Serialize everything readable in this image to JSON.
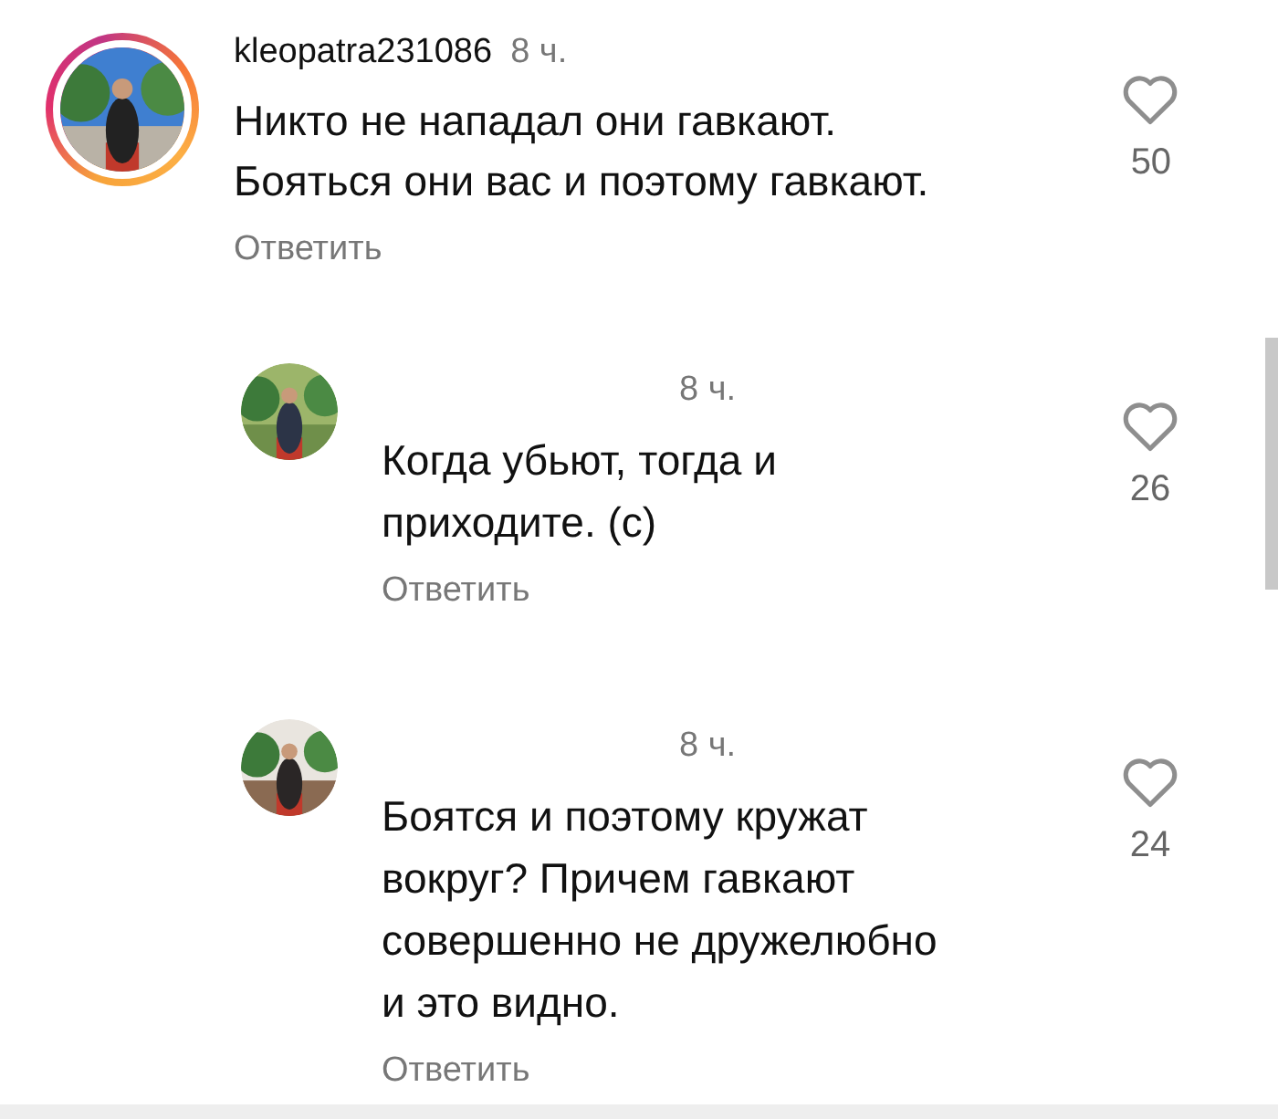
{
  "comments": [
    {
      "kind": "comment",
      "story_ring": true,
      "username": "kleopatra231086",
      "time": "8 ч.",
      "text": "Никто не нападал они гавкают.\nБояться они вас и поэтому гавкают.",
      "reply_label": "Ответить",
      "liked": false,
      "likes": "50"
    },
    {
      "kind": "reply",
      "story_ring": false,
      "time": "8 ч.",
      "text": "Когда убьют, тогда и\nприходите. (с)",
      "reply_label": "Ответить",
      "liked": false,
      "likes": "26"
    },
    {
      "kind": "reply",
      "story_ring": false,
      "time": "8 ч.",
      "text": "Боятся и поэтому кружат\nвокруг? Причем гавкают\nсовершенно не дружелюбно\nи это видно.",
      "reply_label": "Ответить",
      "liked": false,
      "likes": "24"
    }
  ]
}
